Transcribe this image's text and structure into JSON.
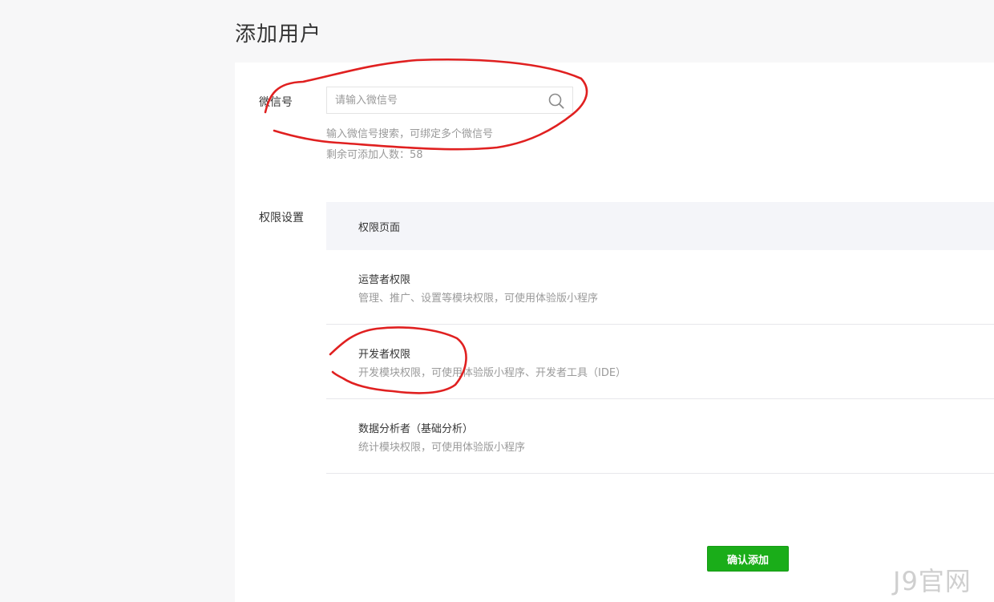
{
  "page": {
    "title": "添加用户"
  },
  "wechat": {
    "label": "微信号",
    "placeholder": "请输入微信号",
    "hint": "输入微信号搜索，可绑定多个微信号",
    "remaining_label": "剩余可添加人数：58",
    "remaining_count": 58
  },
  "permissions": {
    "label": "权限设置",
    "header": "权限页面",
    "items": [
      {
        "title": "运营者权限",
        "desc": "管理、推广、设置等模块权限，可使用体验版小程序"
      },
      {
        "title": "开发者权限",
        "desc": "开发模块权限，可使用体验版小程序、开发者工具（IDE）"
      },
      {
        "title": "数据分析者（基础分析）",
        "desc": "统计模块权限，可使用体验版小程序"
      }
    ]
  },
  "actions": {
    "confirm_label": "确认添加"
  },
  "watermark": "J9官网",
  "colors": {
    "primary_green": "#1aad19",
    "annotation_red": "#e02020",
    "header_bg": "#f4f5f9",
    "page_bg": "#f7f7f8"
  },
  "icons": {
    "search": "search-icon"
  }
}
